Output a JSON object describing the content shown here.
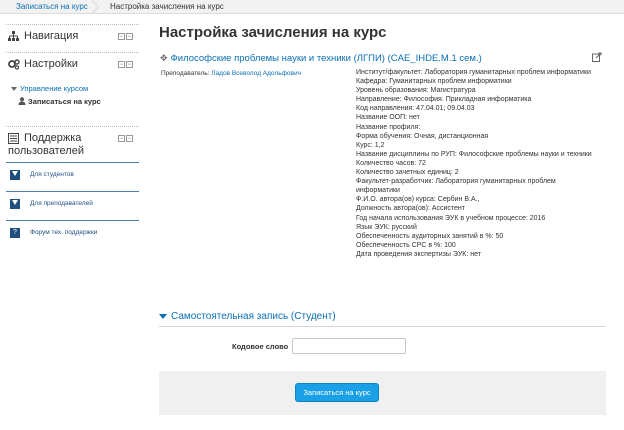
{
  "breadcrumb": {
    "first": "Записаться на курс",
    "current": "Настройка зачисления на курс"
  },
  "sidebar": {
    "navigation": {
      "title": "Навигация",
      "icon": "sitemap-icon"
    },
    "settings": {
      "title": "Настройки",
      "icon": "gears-icon",
      "course_admin": "Управление курсом",
      "enroll": "Записаться на курс"
    },
    "support": {
      "title_line1": "Поддержка",
      "title_line2": "пользователей",
      "icon": "book-icon",
      "items": [
        {
          "label": "Для студентов",
          "icon": "caret-down-icon"
        },
        {
          "label": "Для преподавателей",
          "icon": "caret-down-icon"
        },
        {
          "label": "Форум тех. поддержки",
          "icon": "question-icon"
        }
      ]
    }
  },
  "main": {
    "title": "Настройка зачисления на курс",
    "course_name": "Философские проблемы науки и техники (ЛГПИ) (CAE_IHDE.M.1 сем.)",
    "teacher_label": "Преподаватель:",
    "teacher_name": "Ладов Всеволод Адольфович",
    "info": [
      "Институт/факультет: Лаборатория гуманитарных проблем информатики",
      "Кафедра: Гуманитарных проблем информатики",
      "Уровень образования: Магистратура",
      "Направление: Философия. Прикладная информатика",
      "Код направления: 47.04.01; 09.04.03",
      "Название ООП: нет",
      "Название профиля:",
      "Форма обучения: Очная, дистанционная",
      "Курс: 1,2",
      "Название дисциплины по РУП: Философские проблемы науки и техники",
      "Количество часов: 72",
      "Количество зачетных единиц: 2",
      "Факультет-разработчик: Лаборатория гуманитарных проблем информатики",
      "Ф.И.О. автора(ов) курса: Сербин В.А.,",
      "Должность автора(ов): Ассистент",
      "Год начала использования ЭУК в учебном процессе: 2016",
      "Язык ЭУК: русский",
      "Обеспеченность аудиторных занятий в %: 50",
      "Обеспеченность СРС в %: 100",
      "Дата проведения экспертизы ЭУК: нет"
    ],
    "self_enrol_title": "Самостоятельная запись (Студент)",
    "keyword_label": "Кодовое слово",
    "keyword_value": "",
    "enroll_button": "Записаться на курс"
  },
  "colors": {
    "link": "#0a6fb5",
    "button": "#1aa0e6",
    "support_icon": "#1f4f80"
  }
}
